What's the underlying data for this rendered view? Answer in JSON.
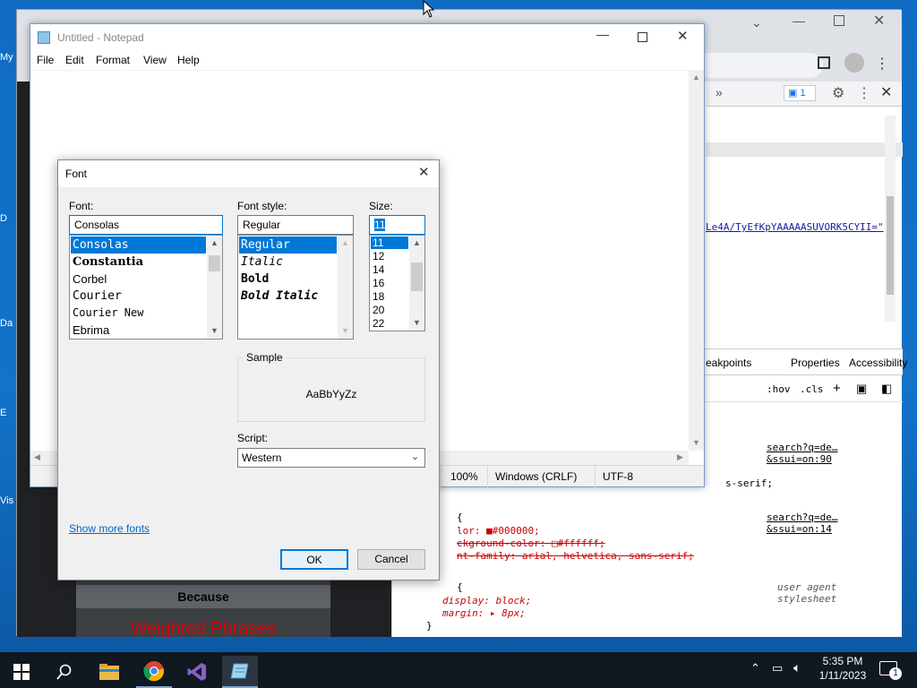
{
  "desktop": {
    "icons": [
      "My",
      "D",
      "Da",
      "E",
      "Vis"
    ]
  },
  "browser": {
    "tabbar_counter": "1",
    "page_bottom": {
      "because": "Because",
      "weighted": "Weighted Phrases"
    },
    "devtools": {
      "url_fragment": "Le4A/TyEfKpYAAAAASUVORK5CYII=\"",
      "tabs": [
        "eakpoints",
        "Properties",
        "Accessibility"
      ],
      "toolbar": [
        ":hov",
        ".cls",
        "+"
      ],
      "rules": [
        {
          "source": "search?q=de…&ssui=on:90",
          "lines": [
            "s-serif;"
          ]
        },
        {
          "source": "search?q=de…&ssui=on:14",
          "lines": [
            "{",
            "lor: ■#000000;",
            "ckground-color: □#ffffff;",
            "nt-family: arial, helvetica, sans-serif;"
          ]
        },
        {
          "source": "user agent stylesheet",
          "lines": [
            "{",
            "display: block;",
            "margin: ▸ 8px;",
            "}"
          ]
        }
      ]
    }
  },
  "notepad": {
    "title": "Untitled - Notepad",
    "menu": [
      "File",
      "Edit",
      "Format",
      "View",
      "Help"
    ],
    "status": {
      "zoom": "100%",
      "line_endings": "Windows (CRLF)",
      "encoding": "UTF-8"
    }
  },
  "font_dialog": {
    "title": "Font",
    "font_label": "Font:",
    "font_value": "Consolas",
    "fonts": [
      "Consolas",
      "Constantia",
      "Corbel",
      "Courier",
      "Courier New",
      "Ebrima"
    ],
    "style_label": "Font style:",
    "style_value": "Regular",
    "styles": [
      "Regular",
      "Italic",
      "Bold",
      "Bold Italic"
    ],
    "size_label": "Size:",
    "size_value": "11",
    "sizes": [
      "11",
      "12",
      "14",
      "16",
      "18",
      "20",
      "22"
    ],
    "sample_label": "Sample",
    "sample_text": "AaBbYyZz",
    "script_label": "Script:",
    "script_value": "Western",
    "more_fonts": "Show more fonts",
    "ok": "OK",
    "cancel": "Cancel"
  },
  "taskbar": {
    "time": "5:35 PM",
    "date": "1/11/2023",
    "notification_count": "1"
  }
}
